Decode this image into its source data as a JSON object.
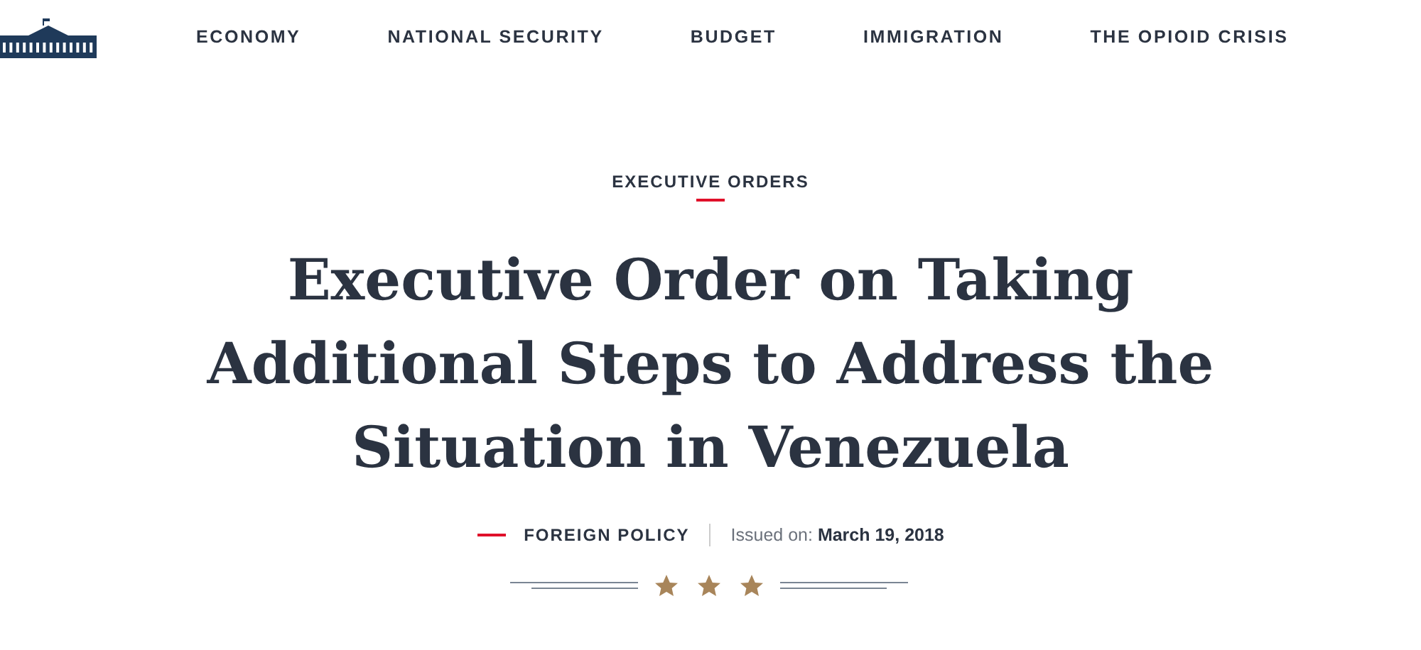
{
  "nav": {
    "items": [
      "ECONOMY",
      "NATIONAL SECURITY",
      "BUDGET",
      "IMMIGRATION",
      "THE OPIOID CRISIS"
    ]
  },
  "article": {
    "category": "EXECUTIVE ORDERS",
    "title": "Executive Order on Taking Additional Steps to Address the Situation in Venezuela",
    "topic": "FOREIGN POLICY",
    "issued": "Issued on: **March 19, 2018**"
  }
}
